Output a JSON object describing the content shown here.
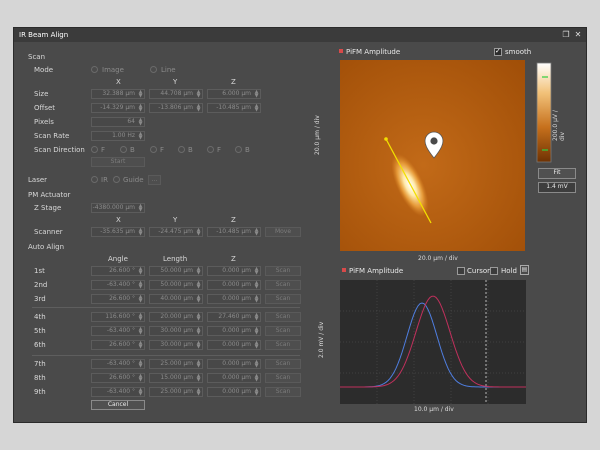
{
  "window": {
    "title": "IR Beam Align"
  },
  "scan": {
    "section": "Scan",
    "mode_label": "Mode",
    "mode_image": "Image",
    "mode_line": "Line",
    "col_x": "X",
    "col_y": "Y",
    "col_z": "Z",
    "size_label": "Size",
    "size": [
      "32.388 µm",
      "44.708 µm",
      "6.000 µm"
    ],
    "offset_label": "Offset",
    "offset": [
      "-14.329 µm",
      "-13.806 µm",
      "-10.485 µm"
    ],
    "pixels_label": "Pixels",
    "pixels": "64",
    "rate_label": "Scan Rate",
    "rate": "1.00 Hz",
    "direction_label": "Scan Direction",
    "direction_opts": [
      "F",
      "B",
      "F",
      "B",
      "F",
      "B"
    ],
    "start": "Start"
  },
  "laser": {
    "label": "Laser",
    "ir": "IR",
    "guide": "Guide",
    "more": "..."
  },
  "pm": {
    "section": "PM Actuator",
    "zstage_label": "Z Stage",
    "zstage": "-4380.000 µm",
    "col_x": "X",
    "col_y": "Y",
    "col_z": "Z",
    "scanner_label": "Scanner",
    "scanner": [
      "-35.635 µm",
      "-24.475 µm",
      "-10.485 µm"
    ],
    "move": "Move"
  },
  "auto": {
    "section": "Auto Align",
    "col_angle": "Angle",
    "col_length": "Length",
    "col_z": "Z",
    "rows": [
      {
        "label": "1st",
        "angle": "26.600 °",
        "length": "50.000 µm",
        "z": "0.000 µm",
        "scan": "Scan"
      },
      {
        "label": "2nd",
        "angle": "-63.400 °",
        "length": "50.000 µm",
        "z": "0.000 µm",
        "scan": "Scan"
      },
      {
        "label": "3rd",
        "angle": "26.600 °",
        "length": "40.000 µm",
        "z": "0.000 µm",
        "scan": "Scan"
      },
      {
        "label": "4th",
        "angle": "116.600 °",
        "length": "20.000 µm",
        "z": "27.460 µm",
        "scan": "Scan"
      },
      {
        "label": "5th",
        "angle": "-63.400 °",
        "length": "30.000 µm",
        "z": "0.000 µm",
        "scan": "Scan"
      },
      {
        "label": "6th",
        "angle": "26.600 °",
        "length": "30.000 µm",
        "z": "0.000 µm",
        "scan": "Scan"
      },
      {
        "label": "7th",
        "angle": "-63.400 °",
        "length": "25.000 µm",
        "z": "0.000 µm",
        "scan": "Scan"
      },
      {
        "label": "8th",
        "angle": "26.600 °",
        "length": "15.000 µm",
        "z": "0.000 µm",
        "scan": "Scan"
      },
      {
        "label": "9th",
        "angle": "-63.400 °",
        "length": "25.000 µm",
        "z": "0.000 µm",
        "scan": "Scan"
      }
    ],
    "cancel": "Cancel"
  },
  "image_panel": {
    "title": "PiFM Amplitude",
    "smooth": "smooth",
    "x_scale": "20.0 µm / div",
    "y_scale": "20.0 µm / div",
    "colorbar_label": "200.0 µV / div",
    "fit": "Fit",
    "value": "1.4 mV"
  },
  "line_panel": {
    "title": "PiFM Amplitude",
    "cursor": "Cursor",
    "hold": "Hold",
    "x_scale": "10.0 µm / div",
    "y_scale": "2.0 mV / div"
  },
  "colors": {
    "accent_red": "#d84a4a",
    "trace_blue": "#4f7ee0",
    "trace_red": "#c0305c",
    "line_yellow": "#f2e000"
  }
}
